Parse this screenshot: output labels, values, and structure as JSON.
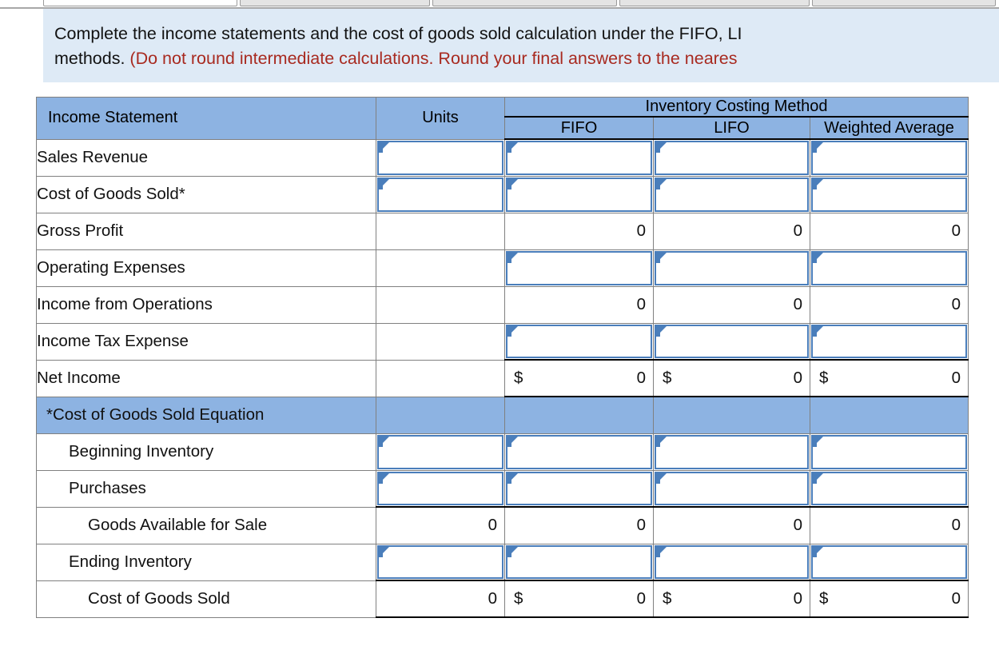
{
  "banner": {
    "line1": "Complete the income statements and the cost of goods sold calculation under the FIFO, LI",
    "line2_black": "methods. ",
    "line2_red": "(Do not round intermediate calculations. Round your final answers to the neares"
  },
  "colors": {
    "banner_bg": "#deeaf6",
    "header_blue": "#8db3e2",
    "input_border": "#4a7ebb",
    "red_text": "#a82a20",
    "grid_line": "#808080"
  },
  "table": {
    "headers": {
      "income_statement": "Income Statement",
      "units": "Units",
      "group": "Inventory Costing Method",
      "fifo": "FIFO",
      "lifo": "LIFO",
      "weighted_average": "Weighted Average"
    },
    "rows": [
      {
        "label": "Sales Revenue",
        "indent": 0,
        "units": {
          "kind": "input"
        },
        "fifo": {
          "kind": "input"
        },
        "lifo": {
          "kind": "input"
        },
        "wavg": {
          "kind": "input"
        }
      },
      {
        "label": "Cost of Goods Sold*",
        "indent": 0,
        "units": {
          "kind": "input"
        },
        "fifo": {
          "kind": "input"
        },
        "lifo": {
          "kind": "input"
        },
        "wavg": {
          "kind": "input"
        }
      },
      {
        "label": "Gross Profit",
        "indent": 0,
        "units": {
          "kind": "blank"
        },
        "fifo": {
          "kind": "value",
          "value": "0"
        },
        "lifo": {
          "kind": "value",
          "value": "0"
        },
        "wavg": {
          "kind": "value",
          "value": "0"
        }
      },
      {
        "label": "Operating Expenses",
        "indent": 0,
        "units": {
          "kind": "blank"
        },
        "fifo": {
          "kind": "input"
        },
        "lifo": {
          "kind": "input"
        },
        "wavg": {
          "kind": "input"
        }
      },
      {
        "label": "Income from Operations",
        "indent": 0,
        "units": {
          "kind": "blank"
        },
        "fifo": {
          "kind": "value",
          "value": "0"
        },
        "lifo": {
          "kind": "value",
          "value": "0"
        },
        "wavg": {
          "kind": "value",
          "value": "0"
        }
      },
      {
        "label": "Income Tax Expense",
        "indent": 0,
        "units": {
          "kind": "blank"
        },
        "fifo": {
          "kind": "input"
        },
        "lifo": {
          "kind": "input"
        },
        "wavg": {
          "kind": "input"
        }
      },
      {
        "label": "Net Income",
        "indent": 0,
        "units": {
          "kind": "blank"
        },
        "fifo": {
          "kind": "value",
          "value": "0",
          "currency": "$"
        },
        "lifo": {
          "kind": "value",
          "value": "0",
          "currency": "$"
        },
        "wavg": {
          "kind": "value",
          "value": "0",
          "currency": "$"
        }
      },
      {
        "label": "*Cost of Goods Sold Equation",
        "indent": 0,
        "section": true,
        "units": {
          "kind": "section"
        },
        "fifo": {
          "kind": "section"
        },
        "lifo": {
          "kind": "section"
        },
        "wavg": {
          "kind": "section"
        }
      },
      {
        "label": "Beginning Inventory",
        "indent": 1,
        "units": {
          "kind": "input"
        },
        "fifo": {
          "kind": "input"
        },
        "lifo": {
          "kind": "input"
        },
        "wavg": {
          "kind": "input"
        }
      },
      {
        "label": "Purchases",
        "indent": 1,
        "units": {
          "kind": "input"
        },
        "fifo": {
          "kind": "input"
        },
        "lifo": {
          "kind": "input"
        },
        "wavg": {
          "kind": "input"
        }
      },
      {
        "label": "Goods Available for Sale",
        "indent": 2,
        "units": {
          "kind": "value",
          "value": "0"
        },
        "fifo": {
          "kind": "value",
          "value": "0"
        },
        "lifo": {
          "kind": "value",
          "value": "0"
        },
        "wavg": {
          "kind": "value",
          "value": "0"
        }
      },
      {
        "label": "Ending Inventory",
        "indent": 1,
        "units": {
          "kind": "input"
        },
        "fifo": {
          "kind": "input"
        },
        "lifo": {
          "kind": "input"
        },
        "wavg": {
          "kind": "input"
        }
      },
      {
        "label": "Cost of Goods Sold",
        "indent": 2,
        "units": {
          "kind": "value",
          "value": "0"
        },
        "fifo": {
          "kind": "value",
          "value": "0",
          "currency": "$"
        },
        "lifo": {
          "kind": "value",
          "value": "0",
          "currency": "$"
        },
        "wavg": {
          "kind": "value",
          "value": "0",
          "currency": "$"
        }
      }
    ]
  }
}
